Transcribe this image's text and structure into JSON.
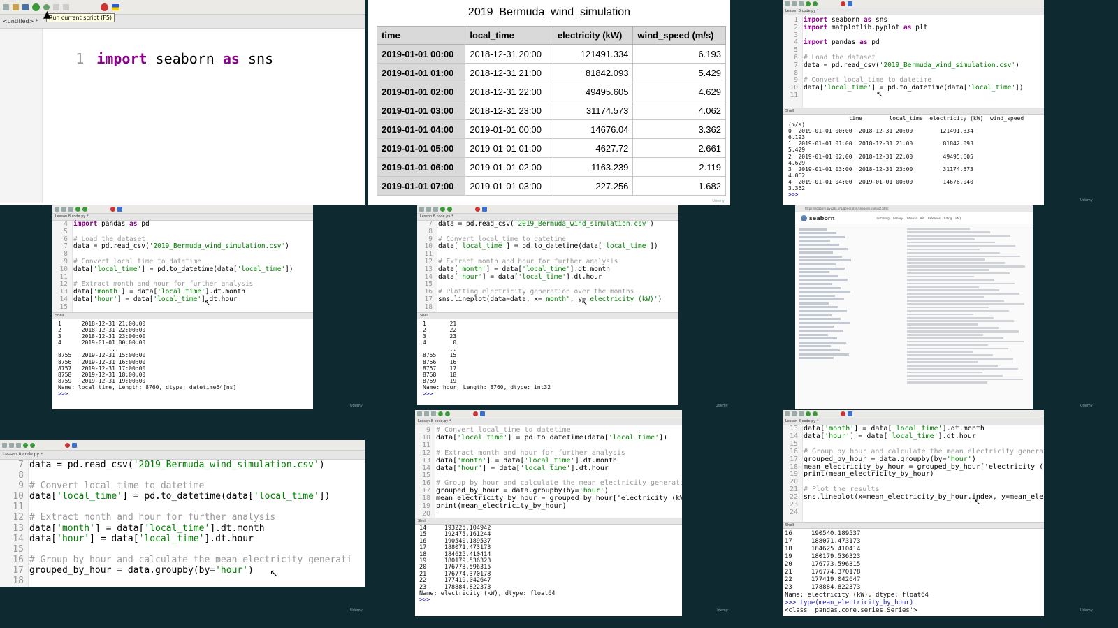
{
  "p1": {
    "tab": "<untitled> *",
    "tooltip": "Run current script (F5)",
    "line_no": "1",
    "code_kw1": "import",
    "code_mod": " seaborn ",
    "code_kw2": "as",
    "code_alias": " sns"
  },
  "table": {
    "title": "2019_Bermuda_wind_simulation",
    "headers": [
      "time",
      "local_time",
      "electricity (kW)",
      "wind_speed (m/s)"
    ],
    "rows": [
      [
        "2019-01-01 00:00",
        "2018-12-31 20:00",
        "121491.334",
        "6.193"
      ],
      [
        "2019-01-01 01:00",
        "2018-12-31 21:00",
        "81842.093",
        "5.429"
      ],
      [
        "2019-01-01 02:00",
        "2018-12-31 22:00",
        "49495.605",
        "4.629"
      ],
      [
        "2019-01-01 03:00",
        "2018-12-31 23:00",
        "31174.573",
        "4.062"
      ],
      [
        "2019-01-01 04:00",
        "2019-01-01 00:00",
        "14676.04",
        "3.362"
      ],
      [
        "2019-01-01 05:00",
        "2019-01-01 01:00",
        "4627.72",
        "2.661"
      ],
      [
        "2019-01-01 06:00",
        "2019-01-01 02:00",
        "1163.239",
        "2.119"
      ],
      [
        "2019-01-01 07:00",
        "2019-01-01 03:00",
        "227.256",
        "1.682"
      ]
    ],
    "watermark": "Udemy"
  },
  "p3": {
    "tab": "Lesson 8 code.py *",
    "lines": [
      [
        "1",
        "import seaborn as sns"
      ],
      [
        "2",
        "import matplotlib.pyplot as plt"
      ],
      [
        "3",
        ""
      ],
      [
        "4",
        "import pandas as pd"
      ],
      [
        "5",
        ""
      ],
      [
        "6",
        "# Load the dataset"
      ],
      [
        "7",
        "data = pd.read_csv('2019_Bermuda_wind_simulation.csv')"
      ],
      [
        "8",
        ""
      ],
      [
        "9",
        "# Convert local_time to datetime"
      ],
      [
        "10",
        "data['local_time'] = pd.to_datetime(data['local_time'])"
      ],
      [
        "11",
        ""
      ]
    ],
    "shell_label": "Shell",
    "shell": [
      "                  time        local_time  electricity (kW)  wind_speed",
      "(m/s)",
      "0  2019-01-01 00:00  2018-12-31 20:00        121491.334",
      "6.193",
      "1  2019-01-01 01:00  2018-12-31 21:00         81842.093",
      "5.429",
      "2  2019-01-01 02:00  2018-12-31 22:00         49495.605",
      "4.629",
      "3  2019-01-01 03:00  2018-12-31 23:00         31174.573",
      "4.062",
      "4  2019-01-01 04:00  2019-01-01 00:00         14676.040",
      "3.362",
      ">>>"
    ]
  },
  "p4": {
    "tab": "Lesson 8 code.py *",
    "lines": [
      [
        "4",
        "import pandas as pd"
      ],
      [
        "5",
        ""
      ],
      [
        "6",
        "# Load the dataset"
      ],
      [
        "7",
        "data = pd.read_csv('2019_Bermuda_wind_simulation.csv')"
      ],
      [
        "8",
        ""
      ],
      [
        "9",
        "# Convert local_time to datetime"
      ],
      [
        "10",
        "data['local_time'] = pd.to_datetime(data['local_time'])"
      ],
      [
        "11",
        ""
      ],
      [
        "12",
        "# Extract month and hour for further analysis"
      ],
      [
        "13",
        "data['month'] = data['local_time'].dt.month"
      ],
      [
        "14",
        "data['hour'] = data['local_time'].dt.hour"
      ],
      [
        "15",
        ""
      ]
    ],
    "shell_label": "Shell",
    "shell": [
      "1      2018-12-31 21:00:00",
      "2      2018-12-31 22:00:00",
      "3      2018-12-31 23:00:00",
      "4      2019-01-01 00:00:00",
      "               ...",
      "8755   2019-12-31 15:00:00",
      "8756   2019-12-31 16:00:00",
      "8757   2019-12-31 17:00:00",
      "8758   2019-12-31 18:00:00",
      "8759   2019-12-31 19:00:00",
      "Name: local_time, Length: 8760, dtype: datetime64[ns]",
      ">>>"
    ]
  },
  "p5": {
    "tab": "Lesson 8 code.py *",
    "lines": [
      [
        "7",
        "data = pd.read_csv('2019_Bermuda_wind_simulation.csv')"
      ],
      [
        "8",
        ""
      ],
      [
        "9",
        "# Convert local_time to datetime"
      ],
      [
        "10",
        "data['local_time'] = pd.to_datetime(data['local_time'])"
      ],
      [
        "11",
        ""
      ],
      [
        "12",
        "# Extract month and hour for further analysis"
      ],
      [
        "13",
        "data['month'] = data['local_time'].dt.month"
      ],
      [
        "14",
        "data['hour'] = data['local_time'].dt.hour"
      ],
      [
        "15",
        ""
      ],
      [
        "16",
        "# Plotting electricity generation over the months"
      ],
      [
        "17",
        "sns.lineplot(data=data, x='month', y='electricity (kW)')"
      ],
      [
        "18",
        ""
      ]
    ],
    "shell_label": "Shell",
    "shell": [
      "1       21",
      "2       22",
      "3       23",
      "4        0",
      "        ..",
      "8755    15",
      "8756    16",
      "8757    17",
      "8758    18",
      "8759    19",
      "Name: hour, Length: 8760, dtype: int32",
      ">>>"
    ]
  },
  "p6": {
    "url": "https://seaborn.pydata.org/generated/seaborn.lineplot.html",
    "brand": "seaborn",
    "nav": [
      "Installing",
      "Gallery",
      "Tutorial",
      "API",
      "Releases",
      "Citing",
      "FAQ"
    ]
  },
  "p7": {
    "tab": "Lesson 8 code.py *",
    "lines": [
      [
        "7",
        "data = pd.read_csv('2019_Bermuda_wind_simulation.csv')"
      ],
      [
        "8",
        ""
      ],
      [
        "9",
        "# Convert local_time to datetime"
      ],
      [
        "10",
        "data['local_time'] = pd.to_datetime(data['local_time'])"
      ],
      [
        "11",
        ""
      ],
      [
        "12",
        "# Extract month and hour for further analysis"
      ],
      [
        "13",
        "data['month'] = data['local_time'].dt.month"
      ],
      [
        "14",
        "data['hour'] = data['local_time'].dt.hour"
      ],
      [
        "15",
        ""
      ],
      [
        "16",
        "# Group by hour and calculate the mean electricity generati"
      ],
      [
        "17",
        "grouped_by_hour = data.groupby(by='hour')"
      ],
      [
        "18",
        ""
      ]
    ]
  },
  "p8": {
    "tab": "Lesson 8 code.py *",
    "lines": [
      [
        "9",
        "# Convert local_time to datetime"
      ],
      [
        "10",
        "data['local_time'] = pd.to_datetime(data['local_time'])"
      ],
      [
        "11",
        ""
      ],
      [
        "12",
        "# Extract month and hour for further analysis"
      ],
      [
        "13",
        "data['month'] = data['local_time'].dt.month"
      ],
      [
        "14",
        "data['hour'] = data['local_time'].dt.hour"
      ],
      [
        "15",
        ""
      ],
      [
        "16",
        "# Group by hour and calculate the mean electricity generati"
      ],
      [
        "17",
        "grouped_by_hour = data.groupby(by='hour')"
      ],
      [
        "18",
        "mean_electricity_by_hour = grouped_by_hour['electricity (kW"
      ],
      [
        "19",
        "print(mean_electricity_by_hour)"
      ],
      [
        "20",
        ""
      ]
    ],
    "shell_label": "Shell",
    "shell": [
      "14     193225.104942",
      "15     192475.161244",
      "16     190540.189537",
      "17     188071.473173",
      "18     184625.410414",
      "19     180179.536323",
      "20     176773.596315",
      "21     176774.370178",
      "22     177419.042647",
      "23     178884.822373",
      "Name: electricity (kW), dtype: float64",
      ">>>"
    ]
  },
  "p9": {
    "tab": "Lesson 8 code.py *",
    "lines": [
      [
        "13",
        "data['month'] = data['local_time'].dt.month"
      ],
      [
        "14",
        "data['hour'] = data['local_time'].dt.hour"
      ],
      [
        "15",
        ""
      ],
      [
        "16",
        "# Group by hour and calculate the mean electricity generati"
      ],
      [
        "17",
        "grouped_by_hour = data.groupby(by='hour')"
      ],
      [
        "18",
        "mean_electricity_by_hour = grouped_by_hour['electricity (kW"
      ],
      [
        "19",
        "print(mean_electricity_by_hour)"
      ],
      [
        "20",
        ""
      ],
      [
        "21",
        "# Plot the results"
      ],
      [
        "22",
        "sns.lineplot(x=mean_electricity_by_hour.index, y=mean_elect"
      ],
      [
        "23",
        ""
      ],
      [
        "24",
        ""
      ]
    ],
    "shell_label": "Shell",
    "shell": [
      "16     190540.189537",
      "17     188071.473173",
      "18     184625.410414",
      "19     180179.536323",
      "20     176773.596315",
      "21     176774.370178",
      "22     177419.042647",
      "23     178884.822373",
      "Name: electricity (kW), dtype: float64",
      ">>> type(mean_electricity_by_hour)",
      "<class 'pandas.core.series.Series'>"
    ]
  },
  "watermark": "Udemy"
}
